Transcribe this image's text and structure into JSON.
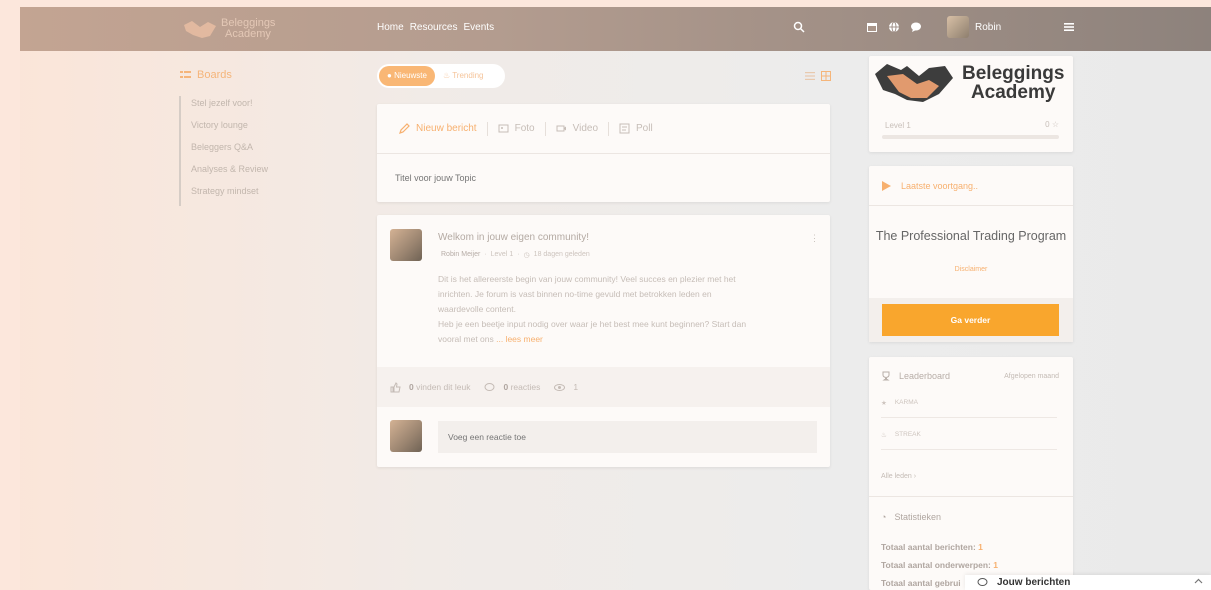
{
  "header": {
    "logo_line1": "Beleggings",
    "logo_line2": "Academy",
    "nav": [
      "Home",
      "Resources",
      "Events"
    ],
    "user_name": "Robin"
  },
  "sidebar": {
    "title": "Boards",
    "items": [
      {
        "label": "Stel jezelf voor!"
      },
      {
        "label": "Victory lounge"
      },
      {
        "label": "Beleggers Q&A"
      },
      {
        "label": "Analyses & Review"
      },
      {
        "label": "Strategy mindset"
      }
    ]
  },
  "feed_tabs": {
    "active": "Nieuwste",
    "other": "Trending"
  },
  "composer": {
    "types": [
      "Nieuw bericht",
      "Foto",
      "Video",
      "Poll"
    ],
    "title_placeholder": "Titel voor jouw Topic"
  },
  "post": {
    "title": "Welkom in jouw eigen community!",
    "author": "Robin Meijer",
    "level": "Level 1",
    "time": "18 dagen geleden",
    "body_lines": [
      "Dit is het allereerste begin van jouw community! Veel succes en plezier met het",
      "inrichten. Je forum is vast binnen no-time gevuld met betrokken leden en",
      "waardevolle content.",
      "Heb je een beetje input nodig over waar je het best mee kunt beginnen? Start dan",
      "vooral met ons"
    ],
    "read_more": "... lees meer",
    "likes_count": "0",
    "likes_label": "vinden dit leuk",
    "reactions_count": "0",
    "reactions_label": "reacties",
    "views": "1",
    "reply_placeholder": "Voeg een reactie toe"
  },
  "profile_card": {
    "brand_line1": "Beleggings",
    "brand_line2": "Academy",
    "level": "Level 1",
    "points": "0",
    "progress": 0
  },
  "course_card": {
    "header": "Laatste voortgang..",
    "title": "The Professional Trading Program",
    "disclaimer": "Disclaimer",
    "button": "Ga verder"
  },
  "leaderboard": {
    "title": "Leaderboard",
    "period": "Afgelopen maand",
    "rows": [
      "KARMA",
      "STREAK"
    ],
    "all_members": "Alle leden",
    "stats_title": "Statistieken",
    "stats": [
      {
        "label": "Totaal aantal berichten:",
        "value": "1"
      },
      {
        "label": "Totaal aantal onderwerpen:",
        "value": "1"
      },
      {
        "label": "Totaal aantal gebrui",
        "value": ""
      }
    ]
  },
  "chat": {
    "label": "Jouw berichten"
  },
  "colors": {
    "accent": "#f7b06f",
    "button": "#f9a62d",
    "topbar_start": "#c3a492",
    "topbar_end": "#8d827c"
  }
}
